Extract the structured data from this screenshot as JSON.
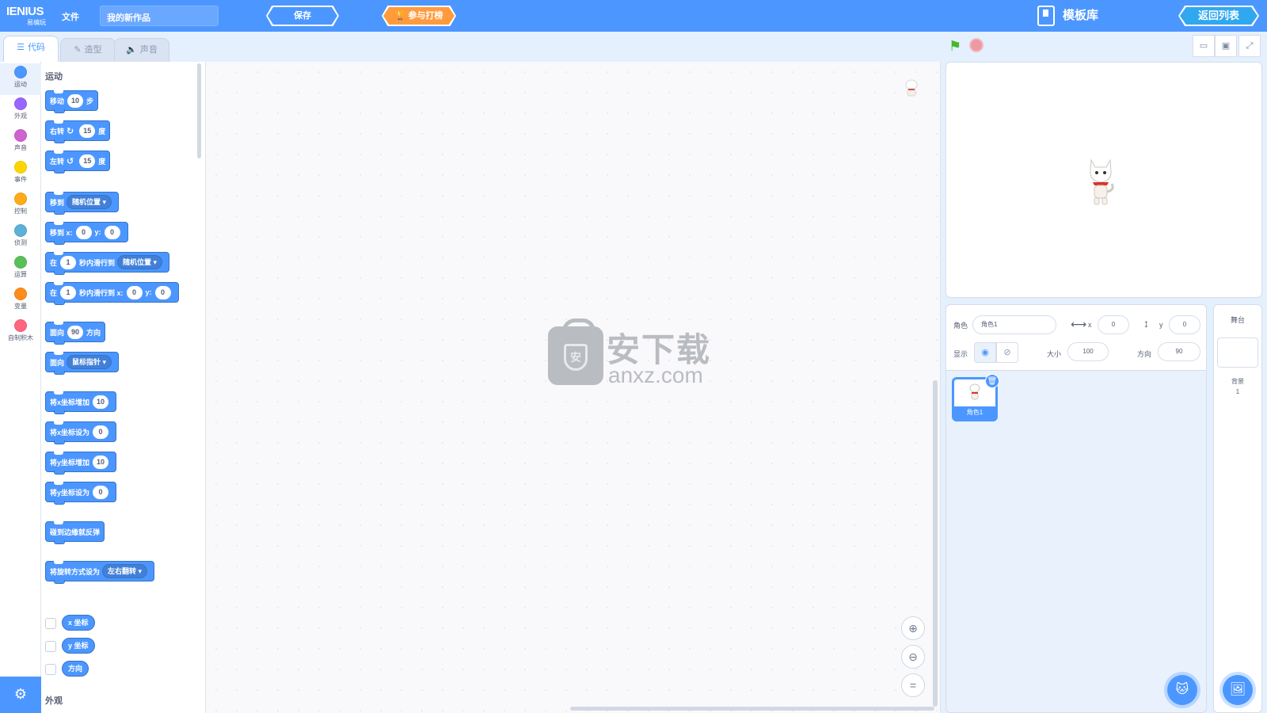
{
  "header": {
    "logo_main": "IENIUS",
    "logo_sub": "易编玩",
    "file_menu": "文件",
    "project_title": "我的新作品",
    "save_label": "保存",
    "rank_label": "参与打榜",
    "template_lib_label": "模板库",
    "back_label": "返回列表",
    "brand_color": "#4c97ff"
  },
  "tabs": [
    {
      "label": "代码",
      "icon": "code-icon"
    },
    {
      "label": "造型",
      "icon": "brush-icon"
    },
    {
      "label": "声音",
      "icon": "speaker-icon"
    }
  ],
  "categories": [
    {
      "label": "运动",
      "color": "#4c97ff"
    },
    {
      "label": "外观",
      "color": "#9966ff"
    },
    {
      "label": "声音",
      "color": "#cf63cf"
    },
    {
      "label": "事件",
      "color": "#ffd500"
    },
    {
      "label": "控制",
      "color": "#ffab19"
    },
    {
      "label": "侦测",
      "color": "#5cb1d6"
    },
    {
      "label": "运算",
      "color": "#59c059"
    },
    {
      "label": "变量",
      "color": "#ff8c1a"
    },
    {
      "label": "自制积木",
      "color": "#ff6680"
    }
  ],
  "palette": {
    "section_motion": "运动",
    "section_looks": "外观",
    "move": {
      "a": "移动",
      "n": "10",
      "b": "步"
    },
    "turn_right": {
      "a": "右转",
      "n": "15",
      "b": "度"
    },
    "turn_left": {
      "a": "左转",
      "n": "15",
      "b": "度"
    },
    "goto": {
      "a": "移到",
      "dd": "随机位置"
    },
    "goto_xy": {
      "a": "移到 x:",
      "x": "0",
      "b": "y:",
      "y": "0"
    },
    "glide": {
      "a": "在",
      "n": "1",
      "b": "秒内滑行到",
      "dd": "随机位置"
    },
    "glide_xy": {
      "a": "在",
      "n": "1",
      "b": "秒内滑行到 x:",
      "x": "0",
      "c": "y:",
      "y": "0"
    },
    "point_dir": {
      "a": "面向",
      "n": "90",
      "b": "方向"
    },
    "point_towards": {
      "a": "面向",
      "dd": "鼠标指针"
    },
    "change_x": {
      "a": "将x坐标增加",
      "n": "10"
    },
    "set_x": {
      "a": "将x坐标设为",
      "n": "0"
    },
    "change_y": {
      "a": "将y坐标增加",
      "n": "10"
    },
    "set_y": {
      "a": "将y坐标设为",
      "n": "0"
    },
    "bounce": "碰到边缘就反弹",
    "rotation_style": {
      "a": "将旋转方式设为",
      "dd": "左右翻转"
    },
    "rep_x": "x 坐标",
    "rep_y": "y 坐标",
    "rep_dir": "方向"
  },
  "watermark": {
    "main": "安下载",
    "sub": "anxz.com",
    "shield": "安"
  },
  "sprite_info": {
    "sprite_label": "角色",
    "sprite_name": "角色1",
    "x_label": "x",
    "x_value": "0",
    "y_label": "y",
    "y_value": "0",
    "show_label": "显示",
    "size_label": "大小",
    "size_value": "100",
    "direction_label": "方向",
    "direction_value": "90"
  },
  "sprite_list": [
    {
      "name": "角色1"
    }
  ],
  "backdrop": {
    "title": "舞台",
    "label": "背景",
    "count": "1"
  }
}
